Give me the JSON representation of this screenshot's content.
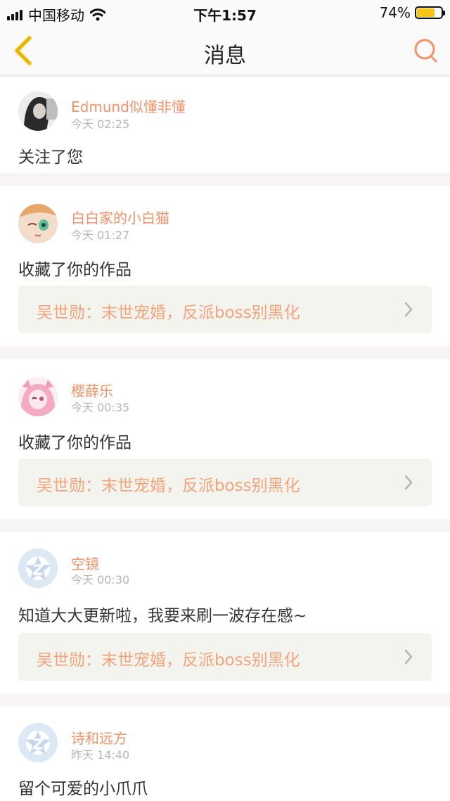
{
  "status_bar": {
    "carrier": "中国移动",
    "time": "下午1:57",
    "battery": "74%",
    "battery_level": 0.74
  },
  "nav": {
    "title": "消息"
  },
  "messages": [
    {
      "user": "Edmund似懂非懂",
      "time": "今天 02:25",
      "action": "关注了您"
    },
    {
      "user": "白白家的小白猫",
      "time": "今天 01:27",
      "action": "收藏了你的作品",
      "work": "吴世勋：末世宠婚，反派boss别黑化"
    },
    {
      "user": "樱薛乐",
      "time": "今天 00:35",
      "action": "收藏了你的作品",
      "work": "吴世勋：末世宠婚，反派boss别黑化"
    },
    {
      "user": "空镜",
      "time": "今天 00:30",
      "action": "知道大大更新啦，我要来刷一波存在感~",
      "work": "吴世勋：末世宠婚，反派boss别黑化"
    },
    {
      "user": "诗和远方",
      "time": "昨天 14:40",
      "action": "留个可爱的小爪爪"
    }
  ],
  "colors": {
    "accent": "#f0926a",
    "back_icon": "#f5c518",
    "card_bg": "#ffffff",
    "page_bg": "#f6f4f5",
    "work_bg": "#f4f4ef"
  }
}
